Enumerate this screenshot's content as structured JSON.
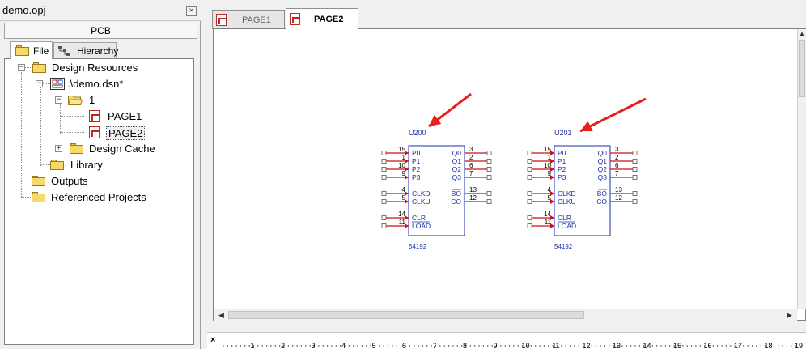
{
  "project": {
    "title": "demo.opj",
    "close_glyph": "×",
    "panel_header": "PCB",
    "tabs": [
      {
        "label": "File",
        "icon": "folder-icon",
        "active": true
      },
      {
        "label": "Hierarchy",
        "icon": "hierarchy-icon",
        "active": false
      }
    ],
    "tree": [
      {
        "label": "Design Resources",
        "icon": "folder-icon",
        "expander": "−"
      },
      {
        "label": ".\\demo.dsn*",
        "icon": "design-icon",
        "expander": "−"
      },
      {
        "label": "1",
        "icon": "open-folder-icon",
        "expander": "−"
      },
      {
        "label": "PAGE1",
        "icon": "schematic-page-icon"
      },
      {
        "label": "PAGE2",
        "icon": "schematic-page-icon"
      },
      {
        "label": "Design Cache",
        "icon": "folder-icon",
        "expander": "+"
      },
      {
        "label": "Library",
        "icon": "folder-icon"
      },
      {
        "label": "Outputs",
        "icon": "folder-icon"
      },
      {
        "label": "Referenced Projects",
        "icon": "folder-icon"
      }
    ]
  },
  "document_tabs": [
    {
      "label": "PAGE1",
      "active": false
    },
    {
      "label": "PAGE2",
      "active": true
    }
  ],
  "schematic": {
    "parts": [
      {
        "ref": "U200",
        "value": "54192",
        "left_pins": [
          {
            "num": "15",
            "name": "P0"
          },
          {
            "num": "1",
            "name": "P1"
          },
          {
            "num": "10",
            "name": "P2"
          },
          {
            "num": "9",
            "name": "P3"
          },
          {
            "num": "4",
            "name": "CLKD"
          },
          {
            "num": "5",
            "name": "CLKU"
          },
          {
            "num": "14",
            "name": "CLR"
          },
          {
            "num": "11",
            "name": "LOAD"
          }
        ],
        "right_pins": [
          {
            "num": "3",
            "name": "Q0"
          },
          {
            "num": "2",
            "name": "Q1"
          },
          {
            "num": "6",
            "name": "Q2"
          },
          {
            "num": "7",
            "name": "Q3"
          },
          {
            "num": "13",
            "name": "BO"
          },
          {
            "num": "12",
            "name": "CO"
          }
        ]
      },
      {
        "ref": "U201",
        "value": "54192",
        "left_pins": [
          {
            "num": "15",
            "name": "P0"
          },
          {
            "num": "1",
            "name": "P1"
          },
          {
            "num": "10",
            "name": "P2"
          },
          {
            "num": "9",
            "name": "P3"
          },
          {
            "num": "4",
            "name": "CLKD"
          },
          {
            "num": "5",
            "name": "CLKU"
          },
          {
            "num": "14",
            "name": "CLR"
          },
          {
            "num": "11",
            "name": "LOAD"
          }
        ],
        "right_pins": [
          {
            "num": "3",
            "name": "Q0"
          },
          {
            "num": "2",
            "name": "Q1"
          },
          {
            "num": "6",
            "name": "Q2"
          },
          {
            "num": "7",
            "name": "Q3"
          },
          {
            "num": "13",
            "name": "BO"
          },
          {
            "num": "12",
            "name": "CO"
          }
        ]
      }
    ],
    "annotation_color": "#e8201c",
    "part_color": "#1c2fa8",
    "pin_color": "#c81414"
  },
  "ruler": {
    "close_glyph": "×",
    "ticks": [
      "1",
      "2",
      "3",
      "4",
      "5",
      "6",
      "7",
      "8",
      "9",
      "10",
      "11",
      "12",
      "13",
      "14",
      "15",
      "16",
      "17",
      "18",
      "19"
    ]
  }
}
